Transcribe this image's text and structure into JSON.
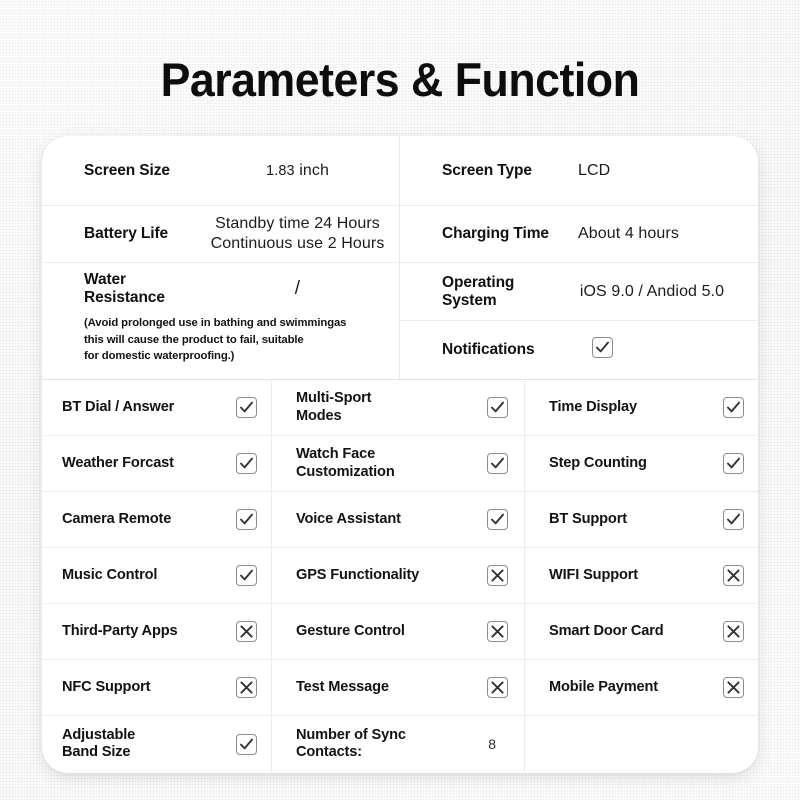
{
  "page": {
    "title": "Parameters & Function",
    "accent_color": "#0d0d0d",
    "card_background": "#ffffff",
    "page_background": "#f2f2f2",
    "divider_color": "#ececec",
    "checkbox_border_color": "#8c8c8c",
    "checkbox_mark_color": "#333333"
  },
  "spec_table": {
    "left_column": [
      {
        "label": "Screen Size",
        "value": "1.83 inch",
        "value_lead": "1.83",
        "value_rest": "inch",
        "type": "rich"
      },
      {
        "label": "Battery Life",
        "value_line_1": "Standby time 24 Hours",
        "value_line_2": "Continuous use 2 Hours",
        "type": "two-line"
      },
      {
        "label": "Water Resistance",
        "label_line_1": "Water",
        "label_line_2": "Resistance",
        "value": "/",
        "type": "slash"
      }
    ],
    "note": "(Avoid prolonged use in bathing and swimmingas this will cause the product to fail, suitable for domestic waterproofing.)",
    "note_line_1": "(Avoid prolonged use in bathing and swimmingas",
    "note_line_2": "this will cause the product to fail, suitable",
    "note_line_3": "for domestic waterproofing.)",
    "right_column": [
      {
        "label": "Screen Type",
        "value": "LCD",
        "type": "text"
      },
      {
        "label": "Charging Time",
        "value": "About 4 hours",
        "type": "text"
      },
      {
        "label": "Operating System",
        "label_line_1": "Operating",
        "label_line_2": "System",
        "value": "iOS 9.0 / Andiod 5.0",
        "type": "text"
      },
      {
        "label": "Notifications",
        "state": "checked",
        "type": "checkbox"
      }
    ]
  },
  "feature_grid": {
    "rows": [
      {
        "col1": {
          "label": "BT Dial / Answer",
          "state": "checked"
        },
        "col2": {
          "label_line_1": "Multi-Sport",
          "label_line_2": "Modes",
          "state": "checked"
        },
        "col3": {
          "label": "Time Display",
          "state": "checked"
        }
      },
      {
        "col1": {
          "label": "Weather Forcast",
          "state": "checked"
        },
        "col2": {
          "label_line_1": "Watch Face",
          "label_line_2": "Customization",
          "state": "checked"
        },
        "col3": {
          "label": "Step Counting",
          "state": "checked"
        }
      },
      {
        "col1": {
          "label": "Camera Remote",
          "state": "checked"
        },
        "col2": {
          "label": "Voice Assistant",
          "state": "checked"
        },
        "col3": {
          "label": "BT Support",
          "state": "checked"
        }
      },
      {
        "col1": {
          "label": "Music Control",
          "state": "checked"
        },
        "col2": {
          "label": "GPS Functionality",
          "state": "crossed"
        },
        "col3": {
          "label": "WIFI Support",
          "state": "crossed"
        }
      },
      {
        "col1": {
          "label": "Third-Party Apps",
          "state": "crossed"
        },
        "col2": {
          "label": "Gesture Control",
          "state": "crossed"
        },
        "col3": {
          "label": "Smart Door Card",
          "state": "crossed"
        }
      },
      {
        "col1": {
          "label": "NFC Support",
          "state": "crossed"
        },
        "col2": {
          "label": "Test Message",
          "state": "crossed"
        },
        "col3": {
          "label": "Mobile Payment",
          "state": "crossed"
        }
      },
      {
        "col1": {
          "label_line_1": "Adjustable",
          "label_line_2": "Band Size",
          "state": "checked"
        },
        "col2": {
          "label_line_1": "Number of Sync",
          "label_line_2": "Contacts:",
          "value": "8",
          "state": "value"
        },
        "col3": {
          "label": "",
          "state": "empty"
        }
      }
    ]
  }
}
